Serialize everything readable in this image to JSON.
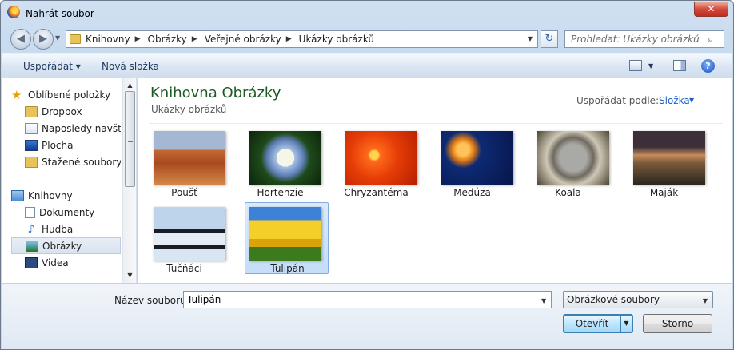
{
  "window": {
    "title": "Nahrát soubor",
    "close_glyph": "✕"
  },
  "nav": {
    "back_glyph": "◀",
    "forward_glyph": "▶",
    "dropdown_glyph": "▼",
    "breadcrumbs": [
      "Knihovny",
      "Obrázky",
      "Veřejné obrázky",
      "Ukázky obrázků"
    ],
    "crumb_separator": "▶",
    "refresh_glyph": "↻",
    "search_placeholder": "Prohledat: Ukázky obrázků",
    "search_icon_glyph": "⌕"
  },
  "toolbar": {
    "organize_label": "Uspořádat ▾",
    "new_folder_label": "Nová složka",
    "views_dd_glyph": "▼",
    "help_glyph": "?"
  },
  "sidebar": {
    "favorites_label": "Oblíbené položky",
    "favorites": [
      "Dropbox",
      "Naposledy navšti",
      "Plocha",
      "Stažené soubory"
    ],
    "libraries_label": "Knihovny",
    "libraries": [
      "Dokumenty",
      "Hudba",
      "Obrázky",
      "Videa"
    ],
    "star_glyph": "★",
    "music_glyph": "♪",
    "scroll_up": "▲",
    "scroll_down": "▼"
  },
  "content": {
    "library_title": "Knihovna Obrázky",
    "library_subtitle": "Ukázky obrázků",
    "arrange_label": "Uspořádat podle:",
    "arrange_value": "Složka",
    "arrange_dd_glyph": "▼",
    "items": [
      "Poušť",
      "Hortenzie",
      "Chryzantéma",
      "Medúza",
      "Koala",
      "Maják",
      "Tučňáci",
      "Tulipán"
    ],
    "selected_item": "Tulipán"
  },
  "footer": {
    "filename_label": "Název souboru:",
    "filename_value": "Tulipán",
    "filename_dd_glyph": "▼",
    "filetype_value": "Obrázkové soubory",
    "filetype_dd_glyph": "▼",
    "open_label": "Otevřít",
    "open_split_glyph": "▼",
    "cancel_label": "Storno"
  }
}
